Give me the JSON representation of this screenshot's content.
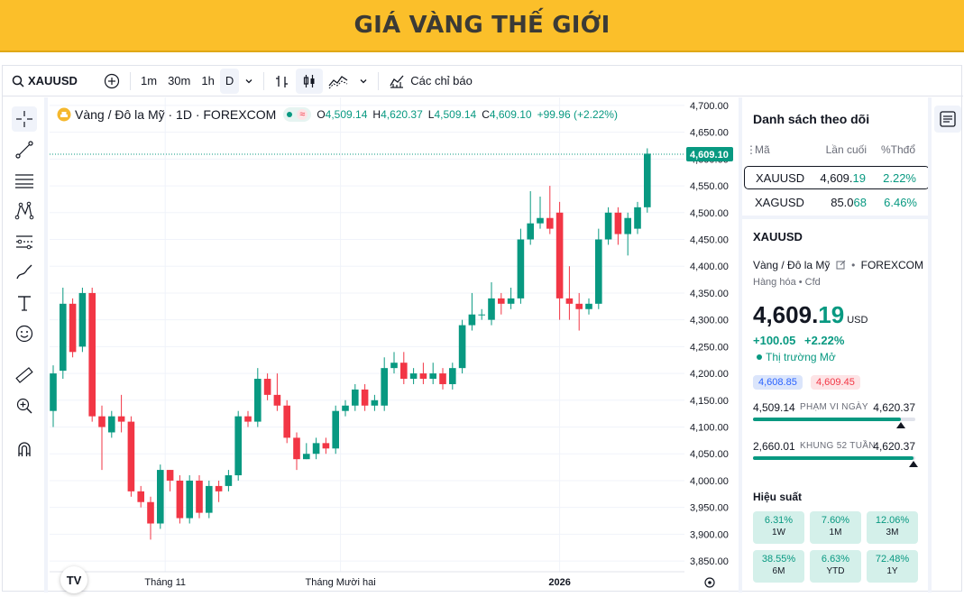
{
  "banner": {
    "title": "GIÁ VÀNG THẾ GIỚI"
  },
  "toolbar": {
    "symbol": "XAUUSD",
    "intervals": [
      "1m",
      "30m",
      "1h",
      "D"
    ],
    "indicators_label": "Các chỉ báo"
  },
  "legend": {
    "name": "Vàng / Đô la Mỹ · 1D · FOREXCOM",
    "o_label": "O",
    "o_value": "4,509.14",
    "h_label": "H",
    "h_value": "4,620.37",
    "l_label": "L",
    "l_value": "4,509.14",
    "c_label": "C",
    "c_value": "4,609.10",
    "change": "+99.96 (+2.22%)"
  },
  "price_axis": {
    "ticks": [
      "4,700.00",
      "4,650.00",
      "4,600.00",
      "4,550.00",
      "4,500.00",
      "4,450.00",
      "4,400.00",
      "4,350.00",
      "4,300.00",
      "4,250.00",
      "4,200.00",
      "4,150.00",
      "4,100.00",
      "4,050.00",
      "4,000.00",
      "3,950.00",
      "3,900.00",
      "3,850.00"
    ],
    "last_price_label": "4,609.10"
  },
  "time_axis": {
    "labels": [
      "Tháng 11",
      "Tháng Mười hai",
      "2026"
    ]
  },
  "watchlist": {
    "title": "Danh sách theo dõi",
    "col_symbol": "Mã",
    "col_last": "Lần cuối",
    "col_change": "%Thđổ",
    "rows": [
      {
        "symbol": "XAUUSD",
        "last_main": "4,609.",
        "last_dec": "19",
        "change": "2.22%"
      },
      {
        "symbol": "XAGUSD",
        "last_main": "85.0",
        "last_dec": "68",
        "change": "6.46%"
      }
    ]
  },
  "details": {
    "symbol": "XAUUSD",
    "description": "Vàng / Đô la Mỹ",
    "exchange": "FOREXCOM",
    "category": "Hàng hóa • Cfd",
    "price_main": "4,609.",
    "price_dec": "19",
    "currency": "USD",
    "change_abs": "+100.05",
    "change_pct": "+2.22%",
    "market_status": "Thị trường Mở",
    "bid": "4,608.85",
    "ask": "4,609.45",
    "day_range": {
      "low": "4,509.14",
      "label": "PHẠM VI NGÀY",
      "high": "4,620.37",
      "position": 0.91
    },
    "week52_range": {
      "low": "2,660.01",
      "label": "KHUNG 52 TUẦN",
      "high": "4,620.37",
      "position": 0.99
    },
    "performance_title": "Hiệu suất",
    "performance": [
      {
        "value": "6.31%",
        "label": "1W"
      },
      {
        "value": "7.60%",
        "label": "1M"
      },
      {
        "value": "12.06%",
        "label": "3M"
      },
      {
        "value": "38.55%",
        "label": "6M"
      },
      {
        "value": "6.63%",
        "label": "YTD"
      },
      {
        "value": "72.48%",
        "label": "1Y"
      }
    ]
  },
  "colors": {
    "up": "#089981",
    "down": "#f23645",
    "banner": "#fbbf2a"
  },
  "chart_data": {
    "type": "candlestick",
    "ylim": [
      3830,
      4715
    ],
    "x_labels": [
      {
        "label": "Tháng 11",
        "index": 11.5
      },
      {
        "label": "Tháng Mười hai",
        "index": 29.5
      },
      {
        "label": "2026",
        "index": 52
      }
    ],
    "candles": [
      [
        4130,
        4200,
        4100,
        4215
      ],
      [
        4205,
        4330,
        4190,
        4360
      ],
      [
        4330,
        4240,
        4230,
        4340
      ],
      [
        4250,
        4350,
        4240,
        4360
      ],
      [
        4350,
        4120,
        4110,
        4360
      ],
      [
        4120,
        4100,
        4020,
        4140
      ],
      [
        4090,
        4120,
        4080,
        4130
      ],
      [
        4120,
        4110,
        4090,
        4160
      ],
      [
        4110,
        3980,
        3970,
        4120
      ],
      [
        3980,
        3960,
        3950,
        3990
      ],
      [
        3960,
        3920,
        3890,
        3970
      ],
      [
        3920,
        4020,
        3910,
        4030
      ],
      [
        4020,
        4000,
        3980,
        4020
      ],
      [
        4000,
        3930,
        3920,
        4010
      ],
      [
        3930,
        4000,
        3920,
        4010
      ],
      [
        4000,
        3940,
        3930,
        4010
      ],
      [
        3940,
        3990,
        3930,
        4000
      ],
      [
        3990,
        3980,
        3960,
        4000
      ],
      [
        3990,
        4010,
        3980,
        4020
      ],
      [
        4010,
        4120,
        4000,
        4130
      ],
      [
        4120,
        4110,
        4100,
        4130
      ],
      [
        4110,
        4190,
        4100,
        4210
      ],
      [
        4190,
        4160,
        4150,
        4200
      ],
      [
        4160,
        4140,
        4130,
        4200
      ],
      [
        4140,
        4080,
        4070,
        4150
      ],
      [
        4080,
        4040,
        4020,
        4090
      ],
      [
        4040,
        4050,
        4040,
        4070
      ],
      [
        4050,
        4070,
        4040,
        4080
      ],
      [
        4070,
        4060,
        4050,
        4080
      ],
      [
        4060,
        4130,
        4050,
        4140
      ],
      [
        4130,
        4140,
        4120,
        4150
      ],
      [
        4140,
        4170,
        4130,
        4180
      ],
      [
        4170,
        4140,
        4130,
        4180
      ],
      [
        4140,
        4150,
        4130,
        4160
      ],
      [
        4140,
        4210,
        4130,
        4230
      ],
      [
        4210,
        4220,
        4200,
        4240
      ],
      [
        4220,
        4190,
        4180,
        4240
      ],
      [
        4190,
        4200,
        4180,
        4210
      ],
      [
        4200,
        4190,
        4180,
        4220
      ],
      [
        4190,
        4200,
        4180,
        4220
      ],
      [
        4200,
        4180,
        4170,
        4210
      ],
      [
        4180,
        4210,
        4170,
        4220
      ],
      [
        4210,
        4290,
        4200,
        4300
      ],
      [
        4290,
        4310,
        4280,
        4350
      ],
      [
        4310,
        4310,
        4300,
        4320
      ],
      [
        4300,
        4340,
        4290,
        4370
      ],
      [
        4340,
        4330,
        4310,
        4350
      ],
      [
        4330,
        4340,
        4320,
        4360
      ],
      [
        4340,
        4450,
        4330,
        4470
      ],
      [
        4450,
        4480,
        4440,
        4540
      ],
      [
        4480,
        4490,
        4470,
        4530
      ],
      [
        4490,
        4470,
        4460,
        4550
      ],
      [
        4500,
        4340,
        4300,
        4520
      ],
      [
        4340,
        4330,
        4300,
        4400
      ],
      [
        4330,
        4320,
        4280,
        4350
      ],
      [
        4320,
        4330,
        4310,
        4340
      ],
      [
        4330,
        4450,
        4320,
        4470
      ],
      [
        4450,
        4500,
        4440,
        4510
      ],
      [
        4500,
        4460,
        4440,
        4510
      ],
      [
        4460,
        4490,
        4420,
        4500
      ],
      [
        4470,
        4510,
        4460,
        4520
      ],
      [
        4510,
        4610,
        4500,
        4620
      ]
    ]
  }
}
